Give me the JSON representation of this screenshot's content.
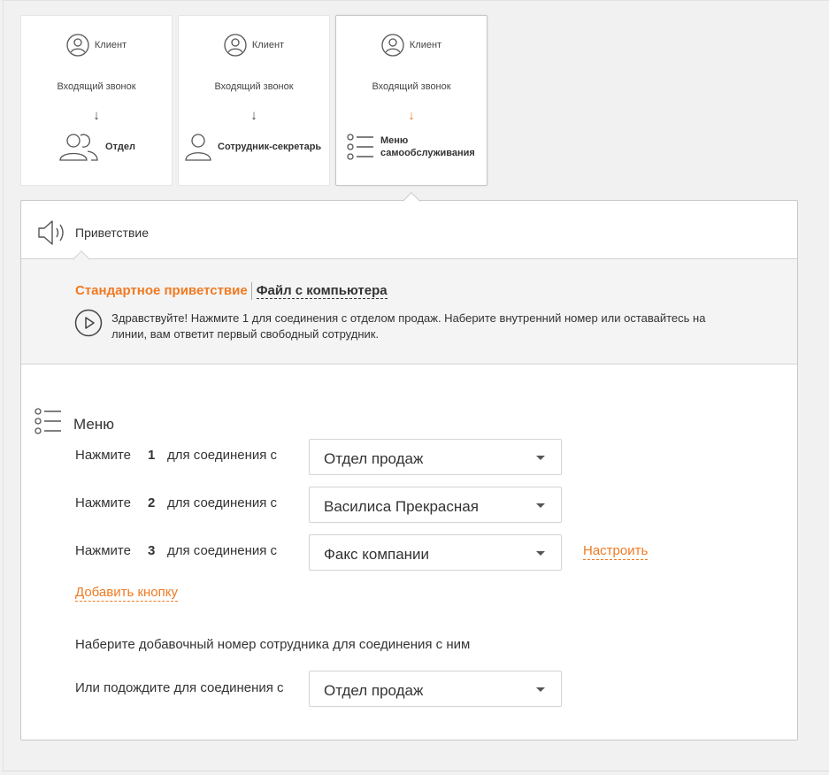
{
  "scenarios": [
    {
      "client_label": "Клиент",
      "call_label": "Входящий звонок",
      "arrow": "↓",
      "dest_label": "Отдел",
      "dest_icon": "group-icon",
      "active": false
    },
    {
      "client_label": "Клиент",
      "call_label": "Входящий звонок",
      "arrow": "↓",
      "dest_label": "Сотрудник-секретарь",
      "dest_icon": "user-icon",
      "active": false
    },
    {
      "client_label": "Клиент",
      "call_label": "Входящий звонок",
      "arrow": "↓",
      "dest_label_line1": "Меню",
      "dest_label_line2": "самообслуживания",
      "dest_icon": "menu-list-icon",
      "active": true
    }
  ],
  "greeting": {
    "title": "Приветствие",
    "icon": "speaker-icon",
    "tab_standard": "Стандартное приветствие",
    "tab_file": "Файл с компьютера",
    "text": "Здравствуйте! Нажмите 1 для соединения с отделом продаж. Наберите внутренний номер или оставайтесь на линии, вам ответит первый свободный сотрудник.",
    "play_icon": "play-icon"
  },
  "menu": {
    "title": "Меню",
    "icon": "menu-list-icon",
    "rows": [
      {
        "press": "Нажмите",
        "number": "1",
        "connect": "для соединения с",
        "value": "Отдел продаж"
      },
      {
        "press": "Нажмите",
        "number": "2",
        "connect": "для соединения с",
        "value": "Василиса Прекрасная"
      },
      {
        "press": "Нажмите",
        "number": "3",
        "connect": "для соединения с",
        "value": "Факс компании",
        "configure": "Настроить"
      }
    ],
    "add_button": "Добавить кнопку",
    "extension_text": "Наберите добавочный номер сотрудника для соединения с ним",
    "wait_label": "Или подождите для соединения с",
    "wait_value": "Отдел продаж"
  },
  "colors": {
    "accent": "#f07a22",
    "text": "#333333",
    "border": "#c8c8c8",
    "panel_bg": "#f4f4f4"
  }
}
